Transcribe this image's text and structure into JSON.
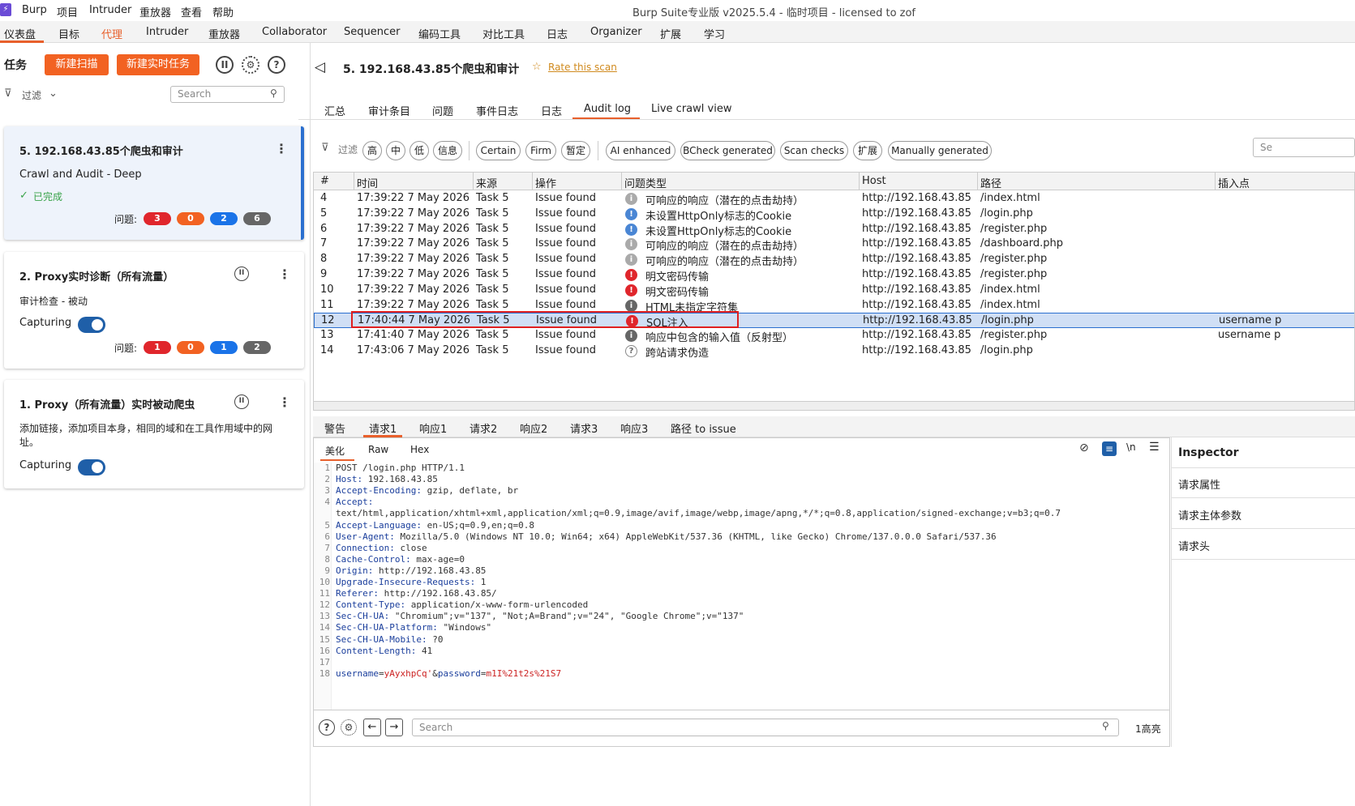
{
  "app": {
    "window_title": "Burp Suite专业版  v2025.5.4 - 临时项目 - licensed to zof",
    "menu": [
      "Burp",
      "项目",
      "Intruder",
      "重放器",
      "查看",
      "帮助"
    ]
  },
  "main_tabs": [
    "仪表盘",
    "目标",
    "代理",
    "Intruder",
    "重放器",
    "Collaborator",
    "Sequencer",
    "编码工具",
    "对比工具",
    "日志",
    "Organizer",
    "扩展",
    "学习"
  ],
  "left": {
    "tasks_label": "任务",
    "new_scan": "新建扫描",
    "new_live_task": "新建实时任务",
    "filter_label": "过滤",
    "search_placeholder": "Search",
    "tasks": [
      {
        "title": "5. 192.168.43.85个爬虫和审计",
        "subtitle": "Crawl and Audit - Deep",
        "status": "已完成",
        "issues_label": "问题:",
        "counts": [
          "3",
          "0",
          "2",
          "6"
        ]
      },
      {
        "title": "2. Proxy实时诊断（所有流量）",
        "subtitle": "审计检查 - 被动",
        "status": "Capturing",
        "issues_label": "问题:",
        "counts": [
          "1",
          "0",
          "1",
          "2"
        ]
      },
      {
        "title": "1. Proxy（所有流量）实时被动爬虫",
        "subtitle": "添加链接，添加项目本身，相同的域和在工具作用域中的网址。",
        "status": "Capturing"
      }
    ]
  },
  "scan": {
    "title": "5. 192.168.43.85个爬虫和审计",
    "rate_label": "Rate this scan",
    "subtabs": [
      "汇总",
      "审计条目",
      "问题",
      "事件日志",
      "日志",
      "Audit log",
      "Live crawl view"
    ],
    "filter_label": "过滤",
    "chips": [
      "高",
      "中",
      "低",
      "信息",
      "Certain",
      "Firm",
      "暂定",
      "AI enhanced",
      "BCheck generated",
      "Scan checks",
      "扩展",
      "Manually generated"
    ],
    "search_partial": "Se"
  },
  "table": {
    "columns": [
      "#",
      "时间",
      "来源",
      "操作",
      "问题类型",
      "Host",
      "路径",
      "插入点"
    ],
    "rows": [
      [
        "4",
        "17:39:22 7 May 2026",
        "Task 5",
        "Issue found",
        "info",
        "可响应的响应（潜在的点击劫持）",
        "http://192.168.43.85",
        "/index.html",
        ""
      ],
      [
        "5",
        "17:39:22 7 May 2026",
        "Task 5",
        "Issue found",
        "low",
        "未设置HttpOnly标志的Cookie",
        "http://192.168.43.85",
        "/login.php",
        ""
      ],
      [
        "6",
        "17:39:22 7 May 2026",
        "Task 5",
        "Issue found",
        "low",
        "未设置HttpOnly标志的Cookie",
        "http://192.168.43.85",
        "/register.php",
        ""
      ],
      [
        "7",
        "17:39:22 7 May 2026",
        "Task 5",
        "Issue found",
        "info",
        "可响应的响应（潜在的点击劫持）",
        "http://192.168.43.85",
        "/dashboard.php",
        ""
      ],
      [
        "8",
        "17:39:22 7 May 2026",
        "Task 5",
        "Issue found",
        "info",
        "可响应的响应（潜在的点击劫持）",
        "http://192.168.43.85",
        "/register.php",
        ""
      ],
      [
        "9",
        "17:39:22 7 May 2026",
        "Task 5",
        "Issue found",
        "high",
        "明文密码传输",
        "http://192.168.43.85",
        "/register.php",
        ""
      ],
      [
        "10",
        "17:39:22 7 May 2026",
        "Task 5",
        "Issue found",
        "high",
        "明文密码传输",
        "http://192.168.43.85",
        "/index.html",
        ""
      ],
      [
        "11",
        "17:39:22 7 May 2026",
        "Task 5",
        "Issue found",
        "dark",
        "HTML未指定字符集",
        "http://192.168.43.85",
        "/index.html",
        ""
      ],
      [
        "12",
        "17:40:44 7 May 2026",
        "Task 5",
        "Issue found",
        "high",
        "SQL注入",
        "http://192.168.43.85",
        "/login.php",
        "username p"
      ],
      [
        "13",
        "17:41:40 7 May 2026",
        "Task 5",
        "Issue found",
        "dark",
        "响应中包含的输入值（反射型）",
        "http://192.168.43.85",
        "/register.php",
        "username p"
      ],
      [
        "14",
        "17:43:06 7 May 2026",
        "Task 5",
        "Issue found",
        "q",
        "跨站请求伪造",
        "http://192.168.43.85",
        "/login.php",
        ""
      ]
    ]
  },
  "detail": {
    "tabs": [
      "警告",
      "请求1",
      "响应1",
      "请求2",
      "响应2",
      "请求3",
      "响应3",
      "路径 to issue"
    ],
    "view_tabs": [
      "美化",
      "Raw",
      "Hex"
    ],
    "request_lines": [
      {
        "n": "1",
        "k": "",
        "v": "POST /login.php HTTP/1.1"
      },
      {
        "n": "2",
        "k": "Host",
        "v": " 192.168.43.85"
      },
      {
        "n": "3",
        "k": "Accept-Encoding",
        "v": " gzip, deflate, br"
      },
      {
        "n": "4",
        "k": "Accept",
        "v": " "
      },
      {
        "n": "",
        "k": "",
        "v": "text/html,application/xhtml+xml,application/xml;q=0.9,image/avif,image/webp,image/apng,*/*;q=0.8,application/signed-exchange;v=b3;q=0.7"
      },
      {
        "n": "5",
        "k": "Accept-Language",
        "v": " en-US;q=0.9,en;q=0.8"
      },
      {
        "n": "6",
        "k": "User-Agent",
        "v": " Mozilla/5.0 (Windows NT 10.0; Win64; x64) AppleWebKit/537.36 (KHTML, like Gecko) Chrome/137.0.0.0 Safari/537.36"
      },
      {
        "n": "7",
        "k": "Connection",
        "v": " close"
      },
      {
        "n": "8",
        "k": "Cache-Control",
        "v": " max-age=0"
      },
      {
        "n": "9",
        "k": "Origin",
        "v": " http://192.168.43.85"
      },
      {
        "n": "10",
        "k": "Upgrade-Insecure-Requests",
        "v": " 1"
      },
      {
        "n": "11",
        "k": "Referer",
        "v": " http://192.168.43.85/"
      },
      {
        "n": "12",
        "k": "Content-Type",
        "v": " application/x-www-form-urlencoded"
      },
      {
        "n": "13",
        "k": "Sec-CH-UA",
        "v": " \"Chromium\";v=\"137\", \"Not;A=Brand\";v=\"24\", \"Google Chrome\";v=\"137\""
      },
      {
        "n": "14",
        "k": "Sec-CH-UA-Platform",
        "v": " \"Windows\""
      },
      {
        "n": "15",
        "k": "Sec-CH-UA-Mobile",
        "v": " ?0"
      },
      {
        "n": "16",
        "k": "Content-Length",
        "v": " 41"
      },
      {
        "n": "17",
        "k": "",
        "v": ""
      }
    ],
    "body_line": {
      "n": "18",
      "p1": "username",
      "v1": "yAyxhpCq'",
      "p2": "password",
      "v2": "m1I%21t2s%21S7"
    },
    "footer_search_placeholder": "Search",
    "highlights": "1高亮"
  },
  "inspector": {
    "title": "Inspector",
    "items": [
      "请求属性",
      "请求主体参数",
      "请求头"
    ]
  },
  "colors": {
    "accent": "#f26222",
    "blue": "#2a6fcf",
    "high": "#e0262c",
    "medium": "#f26222",
    "low": "#1a73e8",
    "info": "#666666"
  }
}
